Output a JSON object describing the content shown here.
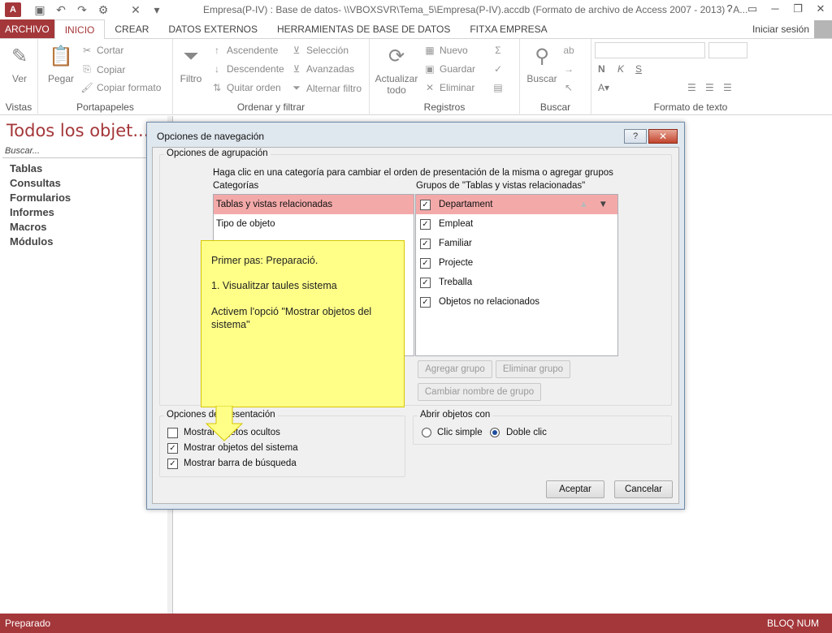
{
  "window": {
    "app_icon": "A",
    "title": "Empresa(P-IV) : Base de datos- \\\\VBOXSVR\\Tema_5\\Empresa(P-IV).accdb (Formato de archivo de Access 2007 - 2013) - A..."
  },
  "ribbon_tabs": [
    "ARCHIVO",
    "INICIO",
    "CREAR",
    "DATOS EXTERNOS",
    "HERRAMIENTAS DE BASE DE DATOS",
    "FITXA EMPRESA"
  ],
  "signin": "Iniciar sesión",
  "ribbon": {
    "vistas": {
      "label": "Vistas",
      "ver": "Ver"
    },
    "portapapeles": {
      "label": "Portapapeles",
      "pegar": "Pegar",
      "cortar": "Cortar",
      "copiar": "Copiar",
      "copiar_formato": "Copiar formato"
    },
    "ordenar": {
      "label": "Ordenar y filtrar",
      "filtro": "Filtro",
      "ascendente": "Ascendente",
      "descendente": "Descendente",
      "quitar_orden": "Quitar orden",
      "seleccion": "Selección",
      "avanzadas": "Avanzadas",
      "alternar": "Alternar filtro"
    },
    "registros": {
      "label": "Registros",
      "actualizar": "Actualizar",
      "todo": "todo",
      "nuevo": "Nuevo",
      "guardar": "Guardar",
      "eliminar": "Eliminar"
    },
    "buscar": {
      "label": "Buscar",
      "buscar": "Buscar"
    },
    "formato": {
      "label": "Formato de texto"
    }
  },
  "navpane": {
    "title": "Todos los objet...",
    "search_placeholder": "Buscar...",
    "items": [
      "Tablas",
      "Consultas",
      "Formularios",
      "Informes",
      "Macros",
      "Módulos"
    ]
  },
  "statusbar": {
    "left": "Preparado",
    "right": "BLOQ NUM"
  },
  "dialog": {
    "title": "Opciones de navegación",
    "help": "?",
    "close": "✕",
    "agrupacion_legend": "Opciones de agrupación",
    "hint": "Haga clic en una categoría para cambiar el orden de presentación de la misma o agregar grupos",
    "categorias_label": "Categorías",
    "categorias": [
      "Tablas y vistas relacionadas",
      "Tipo de objeto"
    ],
    "grupos_label": "Grupos de \"Tablas y vistas relacionadas\"",
    "grupos": [
      {
        "label": "Departament",
        "checked": true
      },
      {
        "label": "Empleat",
        "checked": true
      },
      {
        "label": "Familiar",
        "checked": true
      },
      {
        "label": "Projecte",
        "checked": true
      },
      {
        "label": "Treballa",
        "checked": true
      },
      {
        "label": "Objetos no relacionados",
        "checked": true
      }
    ],
    "agregar_grupo": "Agregar grupo",
    "eliminar_grupo": "Eliminar grupo",
    "cambiar_nombre": "Cambiar nombre de grupo",
    "presentacion_legend": "Opciones de presentación",
    "opciones": [
      {
        "label": "Mostrar objetos ocultos",
        "checked": false
      },
      {
        "label": "Mostrar objetos del sistema",
        "checked": true
      },
      {
        "label": "Mostrar barra de búsqueda",
        "checked": true
      }
    ],
    "abrir_legend": "Abrir objetos con",
    "clic_simple": "Clic simple",
    "doble_clic": "Doble clic",
    "aceptar": "Aceptar",
    "cancelar": "Cancelar"
  },
  "callout": {
    "line1": "Primer pas: Preparació.",
    "line2": "1. Visualitzar taules sistema",
    "line3": "Activem l'opció \"Mostrar objetos del sistema\""
  },
  "colors": {
    "accent": "#a4373a",
    "selection": "#f4a9a9",
    "callout": "#ffff88"
  }
}
